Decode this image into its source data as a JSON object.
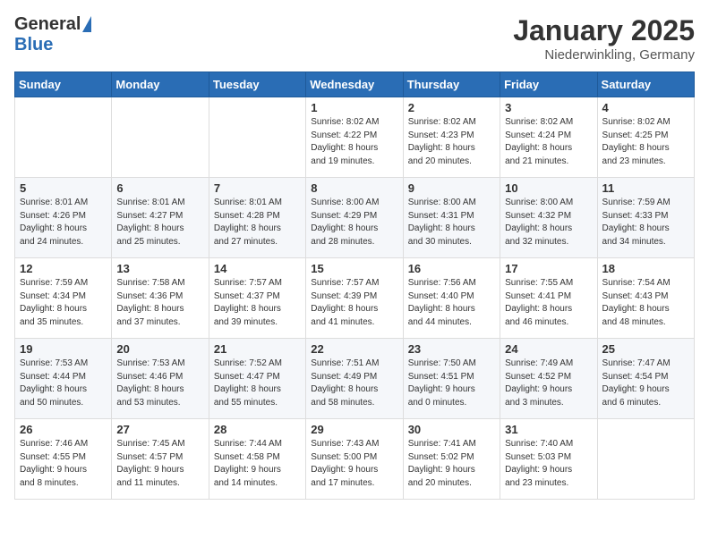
{
  "header": {
    "logo_general": "General",
    "logo_blue": "Blue",
    "month_title": "January 2025",
    "location": "Niederwinkling, Germany"
  },
  "days_of_week": [
    "Sunday",
    "Monday",
    "Tuesday",
    "Wednesday",
    "Thursday",
    "Friday",
    "Saturday"
  ],
  "weeks": [
    [
      {
        "day": "",
        "info": ""
      },
      {
        "day": "",
        "info": ""
      },
      {
        "day": "",
        "info": ""
      },
      {
        "day": "1",
        "info": "Sunrise: 8:02 AM\nSunset: 4:22 PM\nDaylight: 8 hours\nand 19 minutes."
      },
      {
        "day": "2",
        "info": "Sunrise: 8:02 AM\nSunset: 4:23 PM\nDaylight: 8 hours\nand 20 minutes."
      },
      {
        "day": "3",
        "info": "Sunrise: 8:02 AM\nSunset: 4:24 PM\nDaylight: 8 hours\nand 21 minutes."
      },
      {
        "day": "4",
        "info": "Sunrise: 8:02 AM\nSunset: 4:25 PM\nDaylight: 8 hours\nand 23 minutes."
      }
    ],
    [
      {
        "day": "5",
        "info": "Sunrise: 8:01 AM\nSunset: 4:26 PM\nDaylight: 8 hours\nand 24 minutes."
      },
      {
        "day": "6",
        "info": "Sunrise: 8:01 AM\nSunset: 4:27 PM\nDaylight: 8 hours\nand 25 minutes."
      },
      {
        "day": "7",
        "info": "Sunrise: 8:01 AM\nSunset: 4:28 PM\nDaylight: 8 hours\nand 27 minutes."
      },
      {
        "day": "8",
        "info": "Sunrise: 8:00 AM\nSunset: 4:29 PM\nDaylight: 8 hours\nand 28 minutes."
      },
      {
        "day": "9",
        "info": "Sunrise: 8:00 AM\nSunset: 4:31 PM\nDaylight: 8 hours\nand 30 minutes."
      },
      {
        "day": "10",
        "info": "Sunrise: 8:00 AM\nSunset: 4:32 PM\nDaylight: 8 hours\nand 32 minutes."
      },
      {
        "day": "11",
        "info": "Sunrise: 7:59 AM\nSunset: 4:33 PM\nDaylight: 8 hours\nand 34 minutes."
      }
    ],
    [
      {
        "day": "12",
        "info": "Sunrise: 7:59 AM\nSunset: 4:34 PM\nDaylight: 8 hours\nand 35 minutes."
      },
      {
        "day": "13",
        "info": "Sunrise: 7:58 AM\nSunset: 4:36 PM\nDaylight: 8 hours\nand 37 minutes."
      },
      {
        "day": "14",
        "info": "Sunrise: 7:57 AM\nSunset: 4:37 PM\nDaylight: 8 hours\nand 39 minutes."
      },
      {
        "day": "15",
        "info": "Sunrise: 7:57 AM\nSunset: 4:39 PM\nDaylight: 8 hours\nand 41 minutes."
      },
      {
        "day": "16",
        "info": "Sunrise: 7:56 AM\nSunset: 4:40 PM\nDaylight: 8 hours\nand 44 minutes."
      },
      {
        "day": "17",
        "info": "Sunrise: 7:55 AM\nSunset: 4:41 PM\nDaylight: 8 hours\nand 46 minutes."
      },
      {
        "day": "18",
        "info": "Sunrise: 7:54 AM\nSunset: 4:43 PM\nDaylight: 8 hours\nand 48 minutes."
      }
    ],
    [
      {
        "day": "19",
        "info": "Sunrise: 7:53 AM\nSunset: 4:44 PM\nDaylight: 8 hours\nand 50 minutes."
      },
      {
        "day": "20",
        "info": "Sunrise: 7:53 AM\nSunset: 4:46 PM\nDaylight: 8 hours\nand 53 minutes."
      },
      {
        "day": "21",
        "info": "Sunrise: 7:52 AM\nSunset: 4:47 PM\nDaylight: 8 hours\nand 55 minutes."
      },
      {
        "day": "22",
        "info": "Sunrise: 7:51 AM\nSunset: 4:49 PM\nDaylight: 8 hours\nand 58 minutes."
      },
      {
        "day": "23",
        "info": "Sunrise: 7:50 AM\nSunset: 4:51 PM\nDaylight: 9 hours\nand 0 minutes."
      },
      {
        "day": "24",
        "info": "Sunrise: 7:49 AM\nSunset: 4:52 PM\nDaylight: 9 hours\nand 3 minutes."
      },
      {
        "day": "25",
        "info": "Sunrise: 7:47 AM\nSunset: 4:54 PM\nDaylight: 9 hours\nand 6 minutes."
      }
    ],
    [
      {
        "day": "26",
        "info": "Sunrise: 7:46 AM\nSunset: 4:55 PM\nDaylight: 9 hours\nand 8 minutes."
      },
      {
        "day": "27",
        "info": "Sunrise: 7:45 AM\nSunset: 4:57 PM\nDaylight: 9 hours\nand 11 minutes."
      },
      {
        "day": "28",
        "info": "Sunrise: 7:44 AM\nSunset: 4:58 PM\nDaylight: 9 hours\nand 14 minutes."
      },
      {
        "day": "29",
        "info": "Sunrise: 7:43 AM\nSunset: 5:00 PM\nDaylight: 9 hours\nand 17 minutes."
      },
      {
        "day": "30",
        "info": "Sunrise: 7:41 AM\nSunset: 5:02 PM\nDaylight: 9 hours\nand 20 minutes."
      },
      {
        "day": "31",
        "info": "Sunrise: 7:40 AM\nSunset: 5:03 PM\nDaylight: 9 hours\nand 23 minutes."
      },
      {
        "day": "",
        "info": ""
      }
    ]
  ]
}
